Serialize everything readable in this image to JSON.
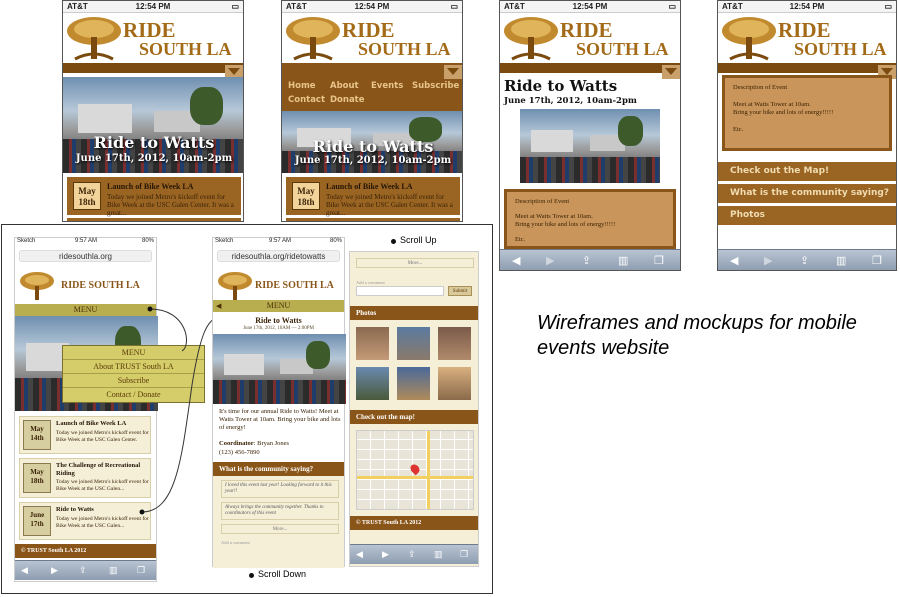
{
  "caption": "Wireframes and mockups for mobile events website",
  "annotations": {
    "scroll_up": "Scroll Up",
    "scroll_down": "Scroll Down"
  },
  "status_bar": {
    "carrier": "AT&T",
    "time": "12:54 PM"
  },
  "brand": {
    "ride": "RIDE",
    "south": "SOUTH LA"
  },
  "hero": {
    "title": "Ride to Watts",
    "date": "June 17th, 2012, 10am-2pm"
  },
  "event_preview": {
    "date_month": "May",
    "date_day": "18th",
    "title": "Launch of Bike Week LA",
    "text": "Today we joined Metro's kickoff event for Bike Week at the USC Galen Center. It was a great..."
  },
  "nav_links": [
    "Home",
    "About",
    "Events",
    "Subscribe",
    "Contact",
    "Donate"
  ],
  "description": {
    "heading": "Description of Event",
    "line1": "Meet at Watts Tower at 10am.",
    "line2": "Bring your bike and lots of energy!!!!!",
    "etc": "Etc."
  },
  "action_buttons": [
    "Check out the Map!",
    "What is the community saying?",
    "Photos"
  ],
  "colors": {
    "brown": "#9a6423",
    "dark_brown": "#7a4a0f",
    "gold_menu": "#b9ae4f",
    "logo": "#a36a17"
  },
  "mockup1": {
    "carrier": "Sketch",
    "time": "9:57 AM",
    "battery": "80%",
    "url": "ridesouthla.org",
    "brand": "RIDE SOUTH LA",
    "menu_label": "MENU",
    "menu_items": [
      "MENU",
      "About TRUST South LA",
      "Subscribe",
      "Contact / Donate"
    ],
    "events": [
      {
        "month": "May",
        "day": "14th",
        "title": "Launch of Bike Week LA",
        "text": "Today we joined Metro's kickoff event for Bike Week at the USC Galen Center."
      },
      {
        "month": "May",
        "day": "18th",
        "title": "The Challenge of Recreational Riding",
        "text": "Today we joined Metro's kickoff event for Bike Week at the USC Galen..."
      },
      {
        "month": "June",
        "day": "17th",
        "title": "Ride to Watts",
        "text": "Today we joined Metro's kickoff event for Bike Week at the USC Galen..."
      }
    ],
    "footer": "© TRUST South LA 2012"
  },
  "mockup2": {
    "carrier": "Sketch",
    "time": "9:57 AM",
    "battery": "80%",
    "url": "ridesouthla.org/ridetowatts",
    "brand": "RIDE SOUTH LA",
    "menu_label": "MENU",
    "event_title": "Ride to Watts",
    "event_date": "June 17th, 2012, 10AM — 2:00PM",
    "body": "It's time for our annual Ride to Watts! Meet at Watts Tower at 10am. Bring your bike and lots of energy!",
    "coordinator_label": "Coordinator",
    "coordinator_name": ": Bryan Jones",
    "phone": "(123) 456-7890",
    "community_heading": "What is the community saying?",
    "comments": [
      "I loved this event last year! Looking forward to it this year!!",
      "Always brings the community together. Thanks to coordinators of this event"
    ],
    "more": "More...",
    "add_comment": "Add a comment"
  },
  "mockup3": {
    "more": "More...",
    "add_comment": "Add a comment",
    "submit": "Submit",
    "photos_heading": "Photos",
    "map_heading": "Check out the map!",
    "footer": "© TRUST South LA 2012"
  }
}
